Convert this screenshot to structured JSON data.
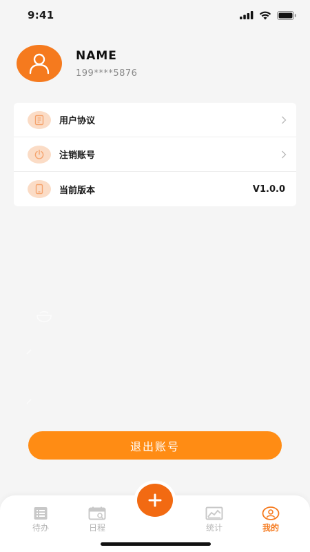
{
  "status_bar": {
    "time": "9:41"
  },
  "profile": {
    "name": "NAME",
    "phone": "199****5876"
  },
  "menu": {
    "items": [
      {
        "label": "用户协议",
        "icon": "document-icon",
        "value": ""
      },
      {
        "label": "注销账号",
        "icon": "power-icon",
        "value": ""
      },
      {
        "label": "当前版本",
        "icon": "phone-icon",
        "value": "V1.0.0"
      }
    ]
  },
  "logout": {
    "label": "退出账号"
  },
  "bottom_nav": {
    "tabs": [
      {
        "label": "待办",
        "icon": "list-icon",
        "active": false
      },
      {
        "label": "日程",
        "icon": "calendar-icon",
        "active": false
      },
      {
        "label": "统计",
        "icon": "chart-icon",
        "active": false
      },
      {
        "label": "我的",
        "icon": "user-circle-icon",
        "active": true
      }
    ],
    "fab_icon": "plus-icon"
  },
  "colors": {
    "accent": "#f57a1e",
    "button": "#ff8c14",
    "icon_bg": "#fbdcc6",
    "background": "#f5f5f5"
  }
}
